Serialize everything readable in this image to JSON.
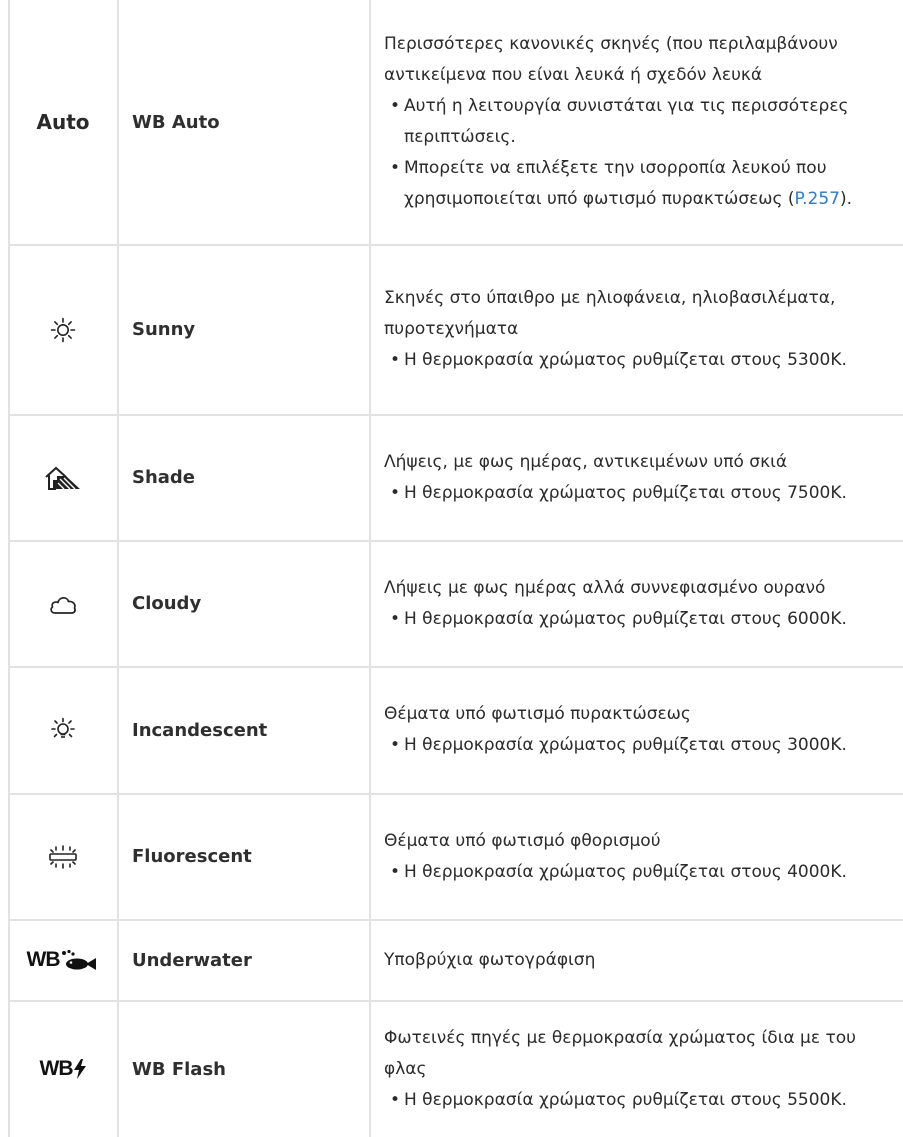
{
  "rows": [
    {
      "icon": "auto-text",
      "icon_text": "Auto",
      "name": "WB Auto",
      "desc": "Περισσότερες κανονικές σκηνές (που περιλαμβάνουν αντικείμενα που είναι λευκά ή σχεδόν λευκά",
      "bullets": [
        "Αυτή η λειτουργία συνιστάται για τις περισσότερες περιπτώσεις."
      ],
      "bullet2_text": "Μπορείτε να επιλέξετε την ισορροπία λευκού που χρησιμοποιείται υπό φωτισμό πυρακτώσεως (",
      "bullet2_link": "P.257",
      "bullet2_end": ")."
    },
    {
      "icon": "sunny-icon",
      "name": "Sunny",
      "desc": "Σκηνές στο ύπαιθρο με ηλιοφάνεια, ηλιοβασιλέματα, πυροτεχνήματα",
      "bullets": [
        "Η θερμοκρασία χρώματος ρυθμίζεται στους 5300K."
      ]
    },
    {
      "icon": "shade-icon",
      "name": "Shade",
      "desc": "Λήψεις, με φως ημέρας, αντικειμένων υπό σκιά",
      "bullets": [
        "Η θερμοκρασία χρώματος ρυθμίζεται στους 7500K."
      ]
    },
    {
      "icon": "cloudy-icon",
      "name": "Cloudy",
      "desc": "Λήψεις με φως ημέρας αλλά συννεφιασμένο ουρανό",
      "bullets": [
        "Η θερμοκρασία χρώματος ρυθμίζεται στους 6000K."
      ]
    },
    {
      "icon": "incandescent-icon",
      "name": "Incandescent",
      "desc": "Θέματα υπό φωτισμό πυρακτώσεως",
      "bullets": [
        "Η θερμοκρασία χρώματος ρυθμίζεται στους 3000K."
      ]
    },
    {
      "icon": "fluorescent-icon",
      "name": "Fluorescent",
      "desc": "Θέματα υπό φωτισμό φθορισμού",
      "bullets": [
        "Η θερμοκρασία χρώματος ρυθμίζεται στους 4000K."
      ]
    },
    {
      "icon": "underwater-icon",
      "icon_text": "WB",
      "name": "Underwater",
      "desc": "Υποβρύχια φωτογράφιση",
      "bullets": []
    },
    {
      "icon": "flash-icon",
      "icon_text": "WB",
      "name": "WB Flash",
      "desc": "Φωτεινές πηγές με θερμοκρασία χρώματος ίδια με του φλας",
      "bullets": [
        "Η θερμοκρασία χρώματος ρυθμίζεται στους 5500K."
      ]
    }
  ],
  "colors": {
    "border": "#e2e2e2",
    "link": "#2a7ad6",
    "text": "#2b2b2b"
  }
}
